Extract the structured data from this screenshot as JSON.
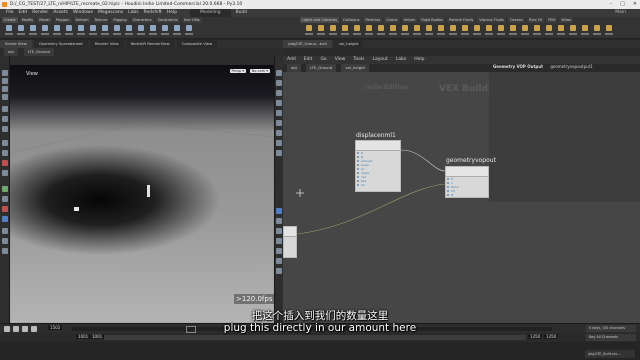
{
  "window": {
    "title": "D:/_CG_TEST/27_LTE_n/HIP/LTE_recreate_02.hiplc - Houdini Indie Limited-Commercial 20.0.668 - Py3.10",
    "controls": [
      "–",
      "□",
      "✕"
    ]
  },
  "menubar": {
    "items": [
      "File",
      "Edit",
      "Render",
      "Assets",
      "Windows",
      "Megascans",
      "Labs",
      "Redshift",
      "Help"
    ],
    "desktop": "Modeling",
    "build": "Build",
    "main": "Main"
  },
  "shelf": {
    "tabs": [
      "Create",
      "Modify",
      "Model",
      "Polygon",
      "Deform",
      "Texture",
      "Rigging",
      "Characters",
      "Constraints",
      "Hair Utils",
      "Guide Process",
      "Terrain FX",
      "Simple FX",
      "Volume"
    ],
    "right_tabs": [
      "Lights and Cameras",
      "Collisions",
      "Particles",
      "Grains",
      "Vellum",
      "Rigid Bodies",
      "Particle Fluids",
      "Viscous Fluids",
      "Oceans",
      "Pyro FX",
      "FEM",
      "Wires",
      "Crowds",
      "Drive Simulation"
    ]
  },
  "viewer": {
    "tabs": [
      "Scene View",
      "Geometry Spreadsheet",
      "Render View",
      "Redshift RenderView",
      "Composite View"
    ],
    "path": [
      "obj",
      "LTE_Ground"
    ],
    "label": "View",
    "persp": "Persp ▾",
    "camera": "No cam ▾",
    "fps": ">120.0fps"
  },
  "network": {
    "tabs": [
      "/obj/LTE_Groun...tcdl",
      "vol_height"
    ],
    "menu": [
      "Add",
      "Edit",
      "Go",
      "View",
      "Tools",
      "Layout",
      "Labs",
      "Help"
    ],
    "path": [
      "obj",
      "LTE_Ground",
      "vol_height"
    ],
    "watermark_indie": "Indie Edition",
    "watermark_vex": "VEX Builder",
    "output_label": "Geometry VOP Output",
    "output_value": "geometryvopoutput1",
    "nodes": [
      {
        "name": "displacenml1",
        "rows": [
          "P",
          "N",
          "amount",
          "scale",
          "sc",
          "nbias",
          "opt",
          "fwd",
          "dir",
          "bias",
          "mask"
        ]
      },
      {
        "name": "geometryvopout",
        "rows": [
          "P",
          "v",
          "force",
          "Cd",
          "N"
        ]
      }
    ]
  },
  "timeline": {
    "frame": "1502",
    "start": "1001",
    "start2": "1001",
    "end": "1350",
    "end2": "1350",
    "keys_label": "0 keys, 0/0 channels",
    "key_all": "Key All Channels",
    "taskbar": "/obj/LTE_Built pic..."
  },
  "subtitles": {
    "chinese": "把这个插入到我们的数量这里",
    "english": "plug this directly in our amount here"
  }
}
